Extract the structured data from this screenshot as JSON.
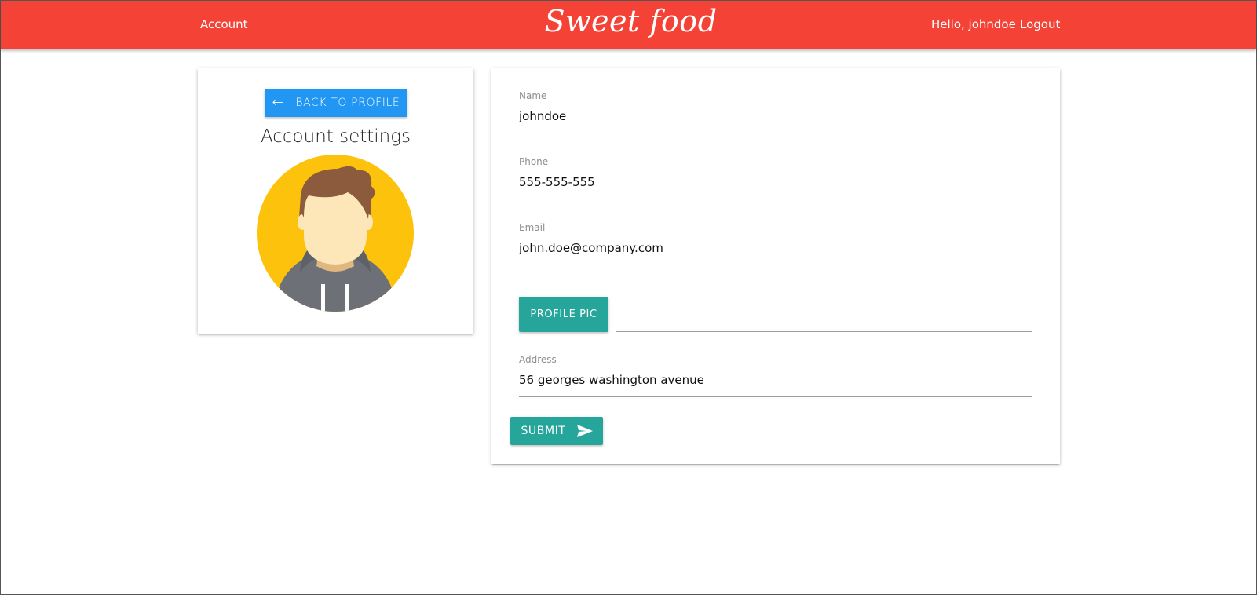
{
  "navbar": {
    "left_link": "Account",
    "brand": "Sweet food",
    "greeting": "Hello, johndoe",
    "logout": "Logout",
    "color": "#f44336"
  },
  "sidebar": {
    "back_button": "BACK TO PROFILE",
    "title": "Account settings",
    "avatar_icon": "user-avatar-icon"
  },
  "form": {
    "name": {
      "label": "Name",
      "value": "johndoe"
    },
    "phone": {
      "label": "Phone",
      "value": "555-555-555"
    },
    "email": {
      "label": "Email",
      "value": "john.doe@company.com"
    },
    "file_button": "PROFILE PIC",
    "address": {
      "label": "Address",
      "value": "56 georges washington avenue"
    },
    "submit": "SUBMIT"
  },
  "colors": {
    "primary_blue": "#2196f3",
    "teal": "#26a69a"
  }
}
